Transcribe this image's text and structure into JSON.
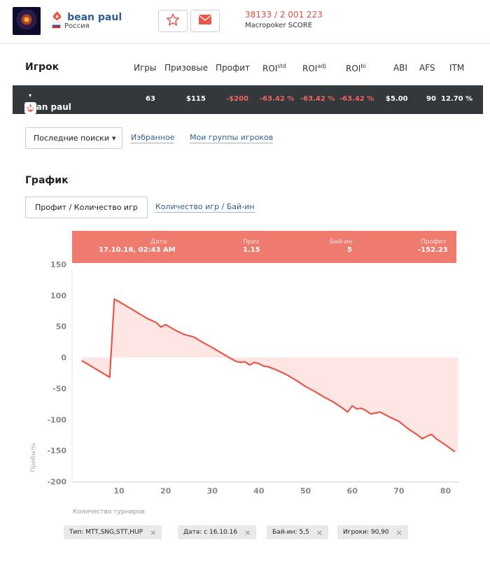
{
  "player": {
    "name": "bean paul",
    "country": "Россия",
    "score_value": "38133 / 2 001 223",
    "score_label": "Macropoker SCORE"
  },
  "table": {
    "headers": {
      "player": "Игрок",
      "games": "Игры",
      "prizes": "Призовые",
      "profit": "Профит",
      "roi_std": "ROI",
      "roi_std_sup": "std",
      "roi_adj": "ROI",
      "roi_adj_sup": "adj",
      "roi_bi": "ROI",
      "roi_bi_sup": "bi",
      "abi": "ABI",
      "afs": "AFS",
      "itm": "ITM"
    },
    "row": {
      "name": "bean paul",
      "caret": "▾",
      "games": "63",
      "prizes": "$115",
      "profit": "-$200",
      "roi_std": "-63.42 %",
      "roi_adj": "-63.42 %",
      "roi_bi": "-63.42 %",
      "abi": "$5.00",
      "afs": "90",
      "itm": "12.70 %"
    }
  },
  "search_tabs": {
    "dropdown_label": "Последние поиски",
    "favorites": "Избранное",
    "groups": "Мои группы игроков"
  },
  "chart_section": {
    "title": "График",
    "tab_active": "Профит / Количество игр",
    "tab_other": "Количество игр / Бай-ин",
    "x_axis_title": "Количество турниров",
    "y_axis_title": "Прибыль"
  },
  "tooltip": {
    "date_label": "Дата",
    "date_value": "17.10.16, 02:43 AM",
    "prize_label": "Приз",
    "prize_value": "1.15",
    "buyin_label": "Бай-ин",
    "buyin_value": "5",
    "profit_label": "Профит",
    "profit_value": "-152.23"
  },
  "filters": [
    {
      "label": "Тип: MTT,SNG,STT,HUP",
      "close": "×"
    },
    {
      "label": "Дата: с 16.10.16",
      "close": "×"
    },
    {
      "label": "Бай-ин: 5,5",
      "close": "×"
    },
    {
      "label": "Игроки: 90,90",
      "close": "×"
    }
  ],
  "colors": {
    "accent_red": "#e8584a",
    "line": "#e8584a",
    "area_fill": "#fde6e3",
    "tooltip_bg": "#ef7b6f",
    "dark_row": "#33383d",
    "link_blue": "#2f5f95"
  },
  "chart_data": {
    "type": "area",
    "xlabel": "Количество турниров",
    "ylabel": "Прибыль",
    "xlim": [
      1,
      83
    ],
    "ylim": [
      -200,
      150
    ],
    "x_ticks": [
      10,
      20,
      30,
      40,
      50,
      60,
      70,
      80
    ],
    "y_ticks": [
      150,
      100,
      50,
      0,
      -50,
      -100,
      -150,
      -200
    ],
    "series": [
      {
        "x": [
          2,
          8,
          9,
          10,
          12,
          14,
          16,
          18,
          19,
          20,
          22,
          24,
          26,
          28,
          30,
          32,
          34,
          35,
          36,
          37,
          38,
          39,
          40,
          41,
          42,
          44,
          46,
          48,
          50,
          52,
          54,
          56,
          58,
          59,
          60,
          61,
          62,
          63,
          64,
          66,
          68,
          70,
          72,
          74,
          75,
          76,
          77,
          78,
          80,
          82
        ],
        "y": [
          -5,
          -32,
          94,
          90,
          81,
          72,
          63,
          56,
          49,
          53,
          44,
          37,
          33,
          24,
          16,
          7,
          -2,
          -6,
          -8,
          -7,
          -12,
          -8,
          -10,
          -14,
          -15,
          -21,
          -28,
          -37,
          -47,
          -55,
          -64,
          -72,
          -82,
          -88,
          -78,
          -83,
          -82,
          -86,
          -91,
          -88,
          -96,
          -103,
          -115,
          -125,
          -131,
          -127,
          -124,
          -131,
          -141,
          -152
        ]
      }
    ]
  }
}
